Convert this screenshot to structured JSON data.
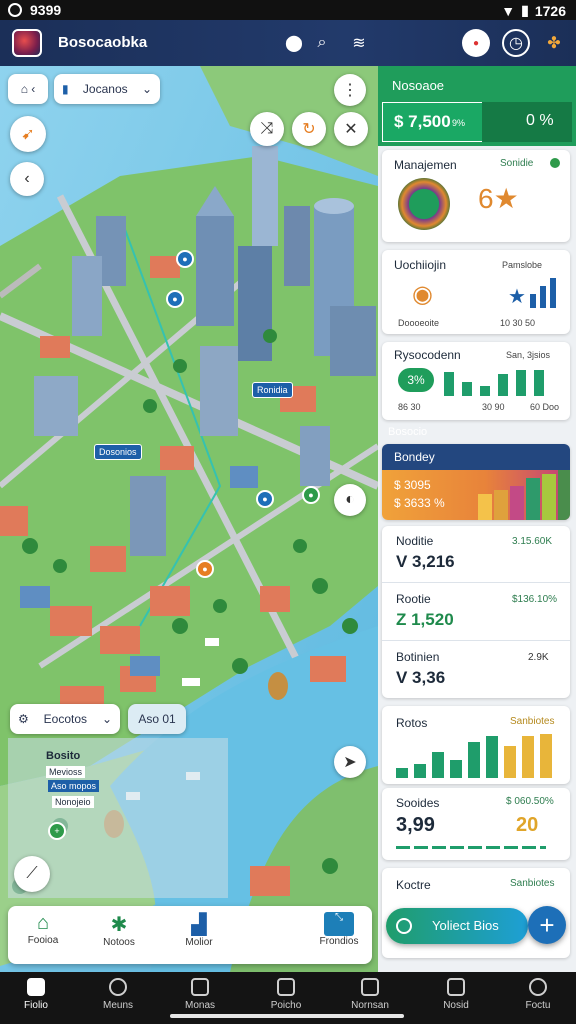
{
  "status_bar": {
    "time_left": "9399",
    "time_right": "1726"
  },
  "app_bar": {
    "title": "Bosocaobka"
  },
  "map": {
    "dropdown_label": "Jocanos",
    "labels": [
      "Ronidia",
      "Dosonios"
    ],
    "legend_chip": "Eocotos",
    "legend_chip_alt": "Aso 01",
    "overlay_title": "Bosito",
    "overlay_line1": "Mevioss",
    "overlay_line2": "Aso mopos",
    "overlay_line3": "Nonojeio",
    "action_buttons": [
      {
        "label": "Fooioa"
      },
      {
        "label": "Notoos"
      },
      {
        "label": "Molior"
      },
      {
        "label": "Frondios"
      }
    ]
  },
  "panel": {
    "header_title": "Nosoaoe",
    "header_value": "$ 7,500",
    "header_unit": "9%",
    "header_right": "0 %",
    "card_management": {
      "title": "Manajemen",
      "status": "Sonidie"
    },
    "card_uochiiojin": {
      "title": "Uochiiojin",
      "subtitle": "Pamslobe",
      "footer_left": "Doooeoite",
      "footer_right": "10 30 50"
    },
    "card_rysoc": {
      "title": "Rysocodenn",
      "subtitle": "San, 3jsios",
      "badge": "3%",
      "footer_left": "86 30",
      "footer_mid": "30 90",
      "footer_right": "60 Doo"
    },
    "section_label": "Bosocio",
    "card_bondey": {
      "title": "Bondey",
      "value": "$ 3095",
      "value2": "$ 3633 %"
    },
    "rows": [
      {
        "label": "Noditie",
        "amount": "3.15.60K",
        "value": "V 3,216"
      },
      {
        "label": "Rootie",
        "amount": "$136.10%",
        "value": "Z 1,520"
      },
      {
        "label": "Botinien",
        "amount": "2.9K",
        "value": "V 3,36"
      }
    ],
    "card_rotos": {
      "title": "Rotos",
      "subtitle": "Sanbiotes"
    },
    "card_soctes": {
      "title": "Sooides",
      "subtitle": "$ 060.50%",
      "value": "3,99",
      "value2": "20"
    },
    "card_koctre": {
      "title": "Koctre",
      "subtitle": "Sanbiotes"
    },
    "fab_label": "Yoliect Bios"
  },
  "bottom_nav": [
    {
      "label": "Fiolio"
    },
    {
      "label": "Meuns"
    },
    {
      "label": "Monas"
    },
    {
      "label": "Poicho"
    },
    {
      "label": "Nornsan"
    },
    {
      "label": "Nosid"
    },
    {
      "label": "Foctu"
    }
  ],
  "colors": {
    "accent": "#1f9d5b",
    "appbar": "#1d3461",
    "bars_green": "#1f9d6b",
    "bars_yellow": "#e8b53a",
    "bars_blue": "#2a6fb8"
  }
}
